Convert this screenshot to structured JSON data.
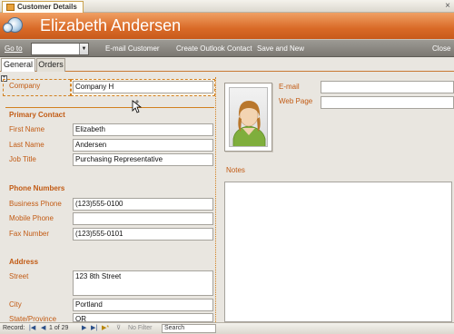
{
  "window": {
    "tab_title": "Customer Details",
    "close_glyph": "×"
  },
  "banner": {
    "title": "Elizabeth Andersen"
  },
  "toolbar": {
    "goto_label": "Go to",
    "goto_value": "",
    "email_customer": "E-mail Customer",
    "create_outlook_contact": "Create Outlook Contact",
    "save_and_new": "Save and New",
    "close": "Close"
  },
  "tabs": [
    {
      "label": "General",
      "active": true
    },
    {
      "label": "Orders",
      "active": false
    }
  ],
  "form": {
    "company": {
      "label": "Company",
      "value": "Company H"
    },
    "primary_contact": {
      "heading": "Primary Contact",
      "first_name": {
        "label": "First Name",
        "value": "Elizabeth"
      },
      "last_name": {
        "label": "Last Name",
        "value": "Andersen"
      },
      "job_title": {
        "label": "Job Title",
        "value": "Purchasing Representative"
      }
    },
    "phone_numbers": {
      "heading": "Phone Numbers",
      "business_phone": {
        "label": "Business Phone",
        "value": "(123)555-0100"
      },
      "mobile_phone": {
        "label": "Mobile Phone",
        "value": ""
      },
      "fax_number": {
        "label": "Fax Number",
        "value": "(123)555-0101"
      }
    },
    "address": {
      "heading": "Address",
      "street": {
        "label": "Street",
        "value": "123 8th Street"
      },
      "city": {
        "label": "City",
        "value": "Portland"
      },
      "state": {
        "label": "State/Province",
        "value": "OR"
      }
    },
    "email": {
      "label": "E-mail",
      "value": ""
    },
    "web_page": {
      "label": "Web Page",
      "value": ""
    },
    "notes": {
      "label": "Notes",
      "value": ""
    }
  },
  "status_bar": {
    "record_label": "Record:",
    "record_position": "1 of 29",
    "filter_label": "No Filter",
    "search_label": "Search"
  },
  "colors": {
    "accent": "#d96a27",
    "label_text": "#c25b14"
  },
  "icons": [
    "database-icon",
    "dropdown-arrow-icon",
    "contact-photo-icon",
    "move-cursor-icon",
    "first-record-icon",
    "previous-record-icon",
    "next-record-icon",
    "last-record-icon",
    "new-record-icon",
    "filter-icon"
  ]
}
